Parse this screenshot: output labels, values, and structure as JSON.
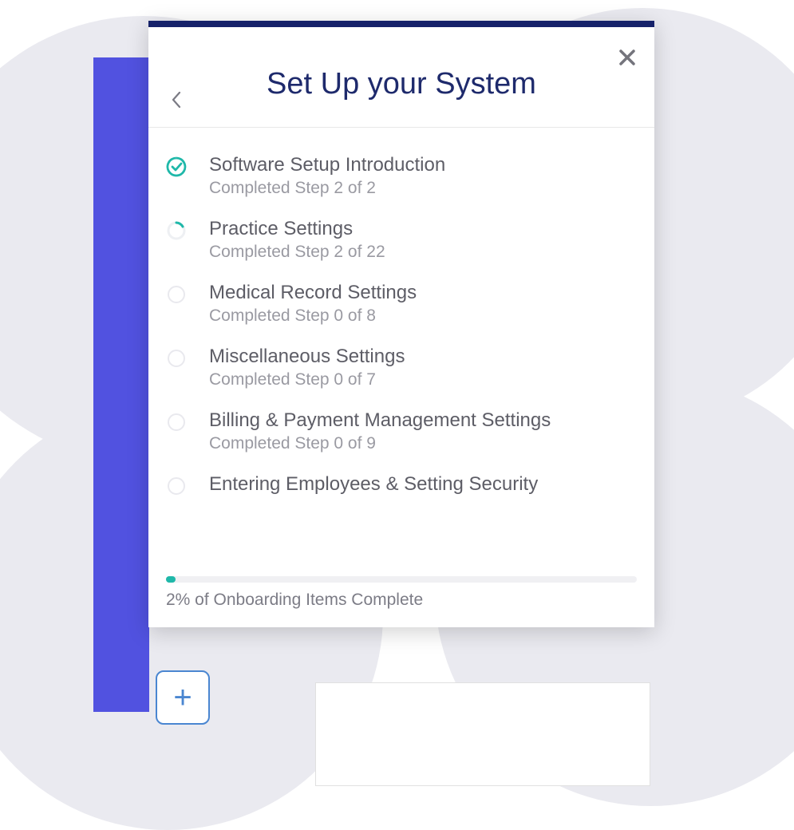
{
  "header": {
    "title": "Set Up your System"
  },
  "items": [
    {
      "title": "Software Setup Introduction",
      "sub": "Completed Step 2 of 2",
      "status": "complete"
    },
    {
      "title": "Practice Settings",
      "sub": "Completed Step 2 of 22",
      "status": "partial"
    },
    {
      "title": "Medical Record Settings",
      "sub": "Completed Step 0 of 8",
      "status": "empty"
    },
    {
      "title": "Miscellaneous Settings",
      "sub": "Completed Step 0 of 7",
      "status": "empty"
    },
    {
      "title": "Billing & Payment Management Settings",
      "sub": "Completed Step 0 of 9",
      "status": "empty"
    },
    {
      "title": "Entering Employees & Setting Security",
      "sub": "",
      "status": "empty"
    }
  ],
  "progress": {
    "percent": 2,
    "label": "2% of Onboarding Items Complete"
  },
  "colors": {
    "accent_teal": "#1fb8a9",
    "brand_navy": "#1e2a6c",
    "brand_purple": "#5152e0"
  },
  "plus_button": {
    "glyph": "+"
  }
}
